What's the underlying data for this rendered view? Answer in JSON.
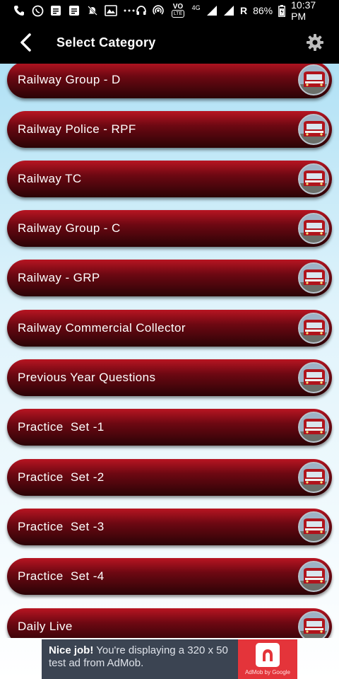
{
  "status_bar": {
    "battery": "86%",
    "roaming": "R",
    "network": "4G",
    "volte": "VO",
    "time": "10:37 PM",
    "left_icons": [
      "phone-icon",
      "whatsapp-icon",
      "message-icon",
      "message-icon",
      "mute-icon",
      "gallery-icon",
      "more-icon"
    ],
    "right_icons": [
      "headset-icon",
      "hotspot-icon",
      "volte-icon",
      "signal-icon",
      "signal-icon",
      "battery-icon"
    ]
  },
  "app_bar": {
    "title": "Select Category",
    "back_icon": "back-arrow-icon",
    "settings_icon": "gear-icon"
  },
  "categories": [
    {
      "label": "Railway Group - D"
    },
    {
      "label": "Railway Police - RPF"
    },
    {
      "label": "Railway TC"
    },
    {
      "label": "Railway Group - C"
    },
    {
      "label": "Railway - GRP"
    },
    {
      "label": "Railway Commercial Collector"
    },
    {
      "label": "Previous Year Questions"
    },
    {
      "label": "Practice  Set -1"
    },
    {
      "label": "Practice  Set -2"
    },
    {
      "label": "Practice  Set -3"
    },
    {
      "label": "Practice  Set -4"
    },
    {
      "label": "Daily Live"
    }
  ],
  "ad": {
    "headline": "Nice job!",
    "body": " You're displaying a 320 x 50 test ad from AdMob.",
    "brand": "AdMob by Google"
  },
  "colors": {
    "item_top": "#b81522",
    "item_bottom": "#2a0306",
    "bar": "#000000",
    "ad_bg": "#3b4452",
    "ad_logo": "#e4343a"
  }
}
